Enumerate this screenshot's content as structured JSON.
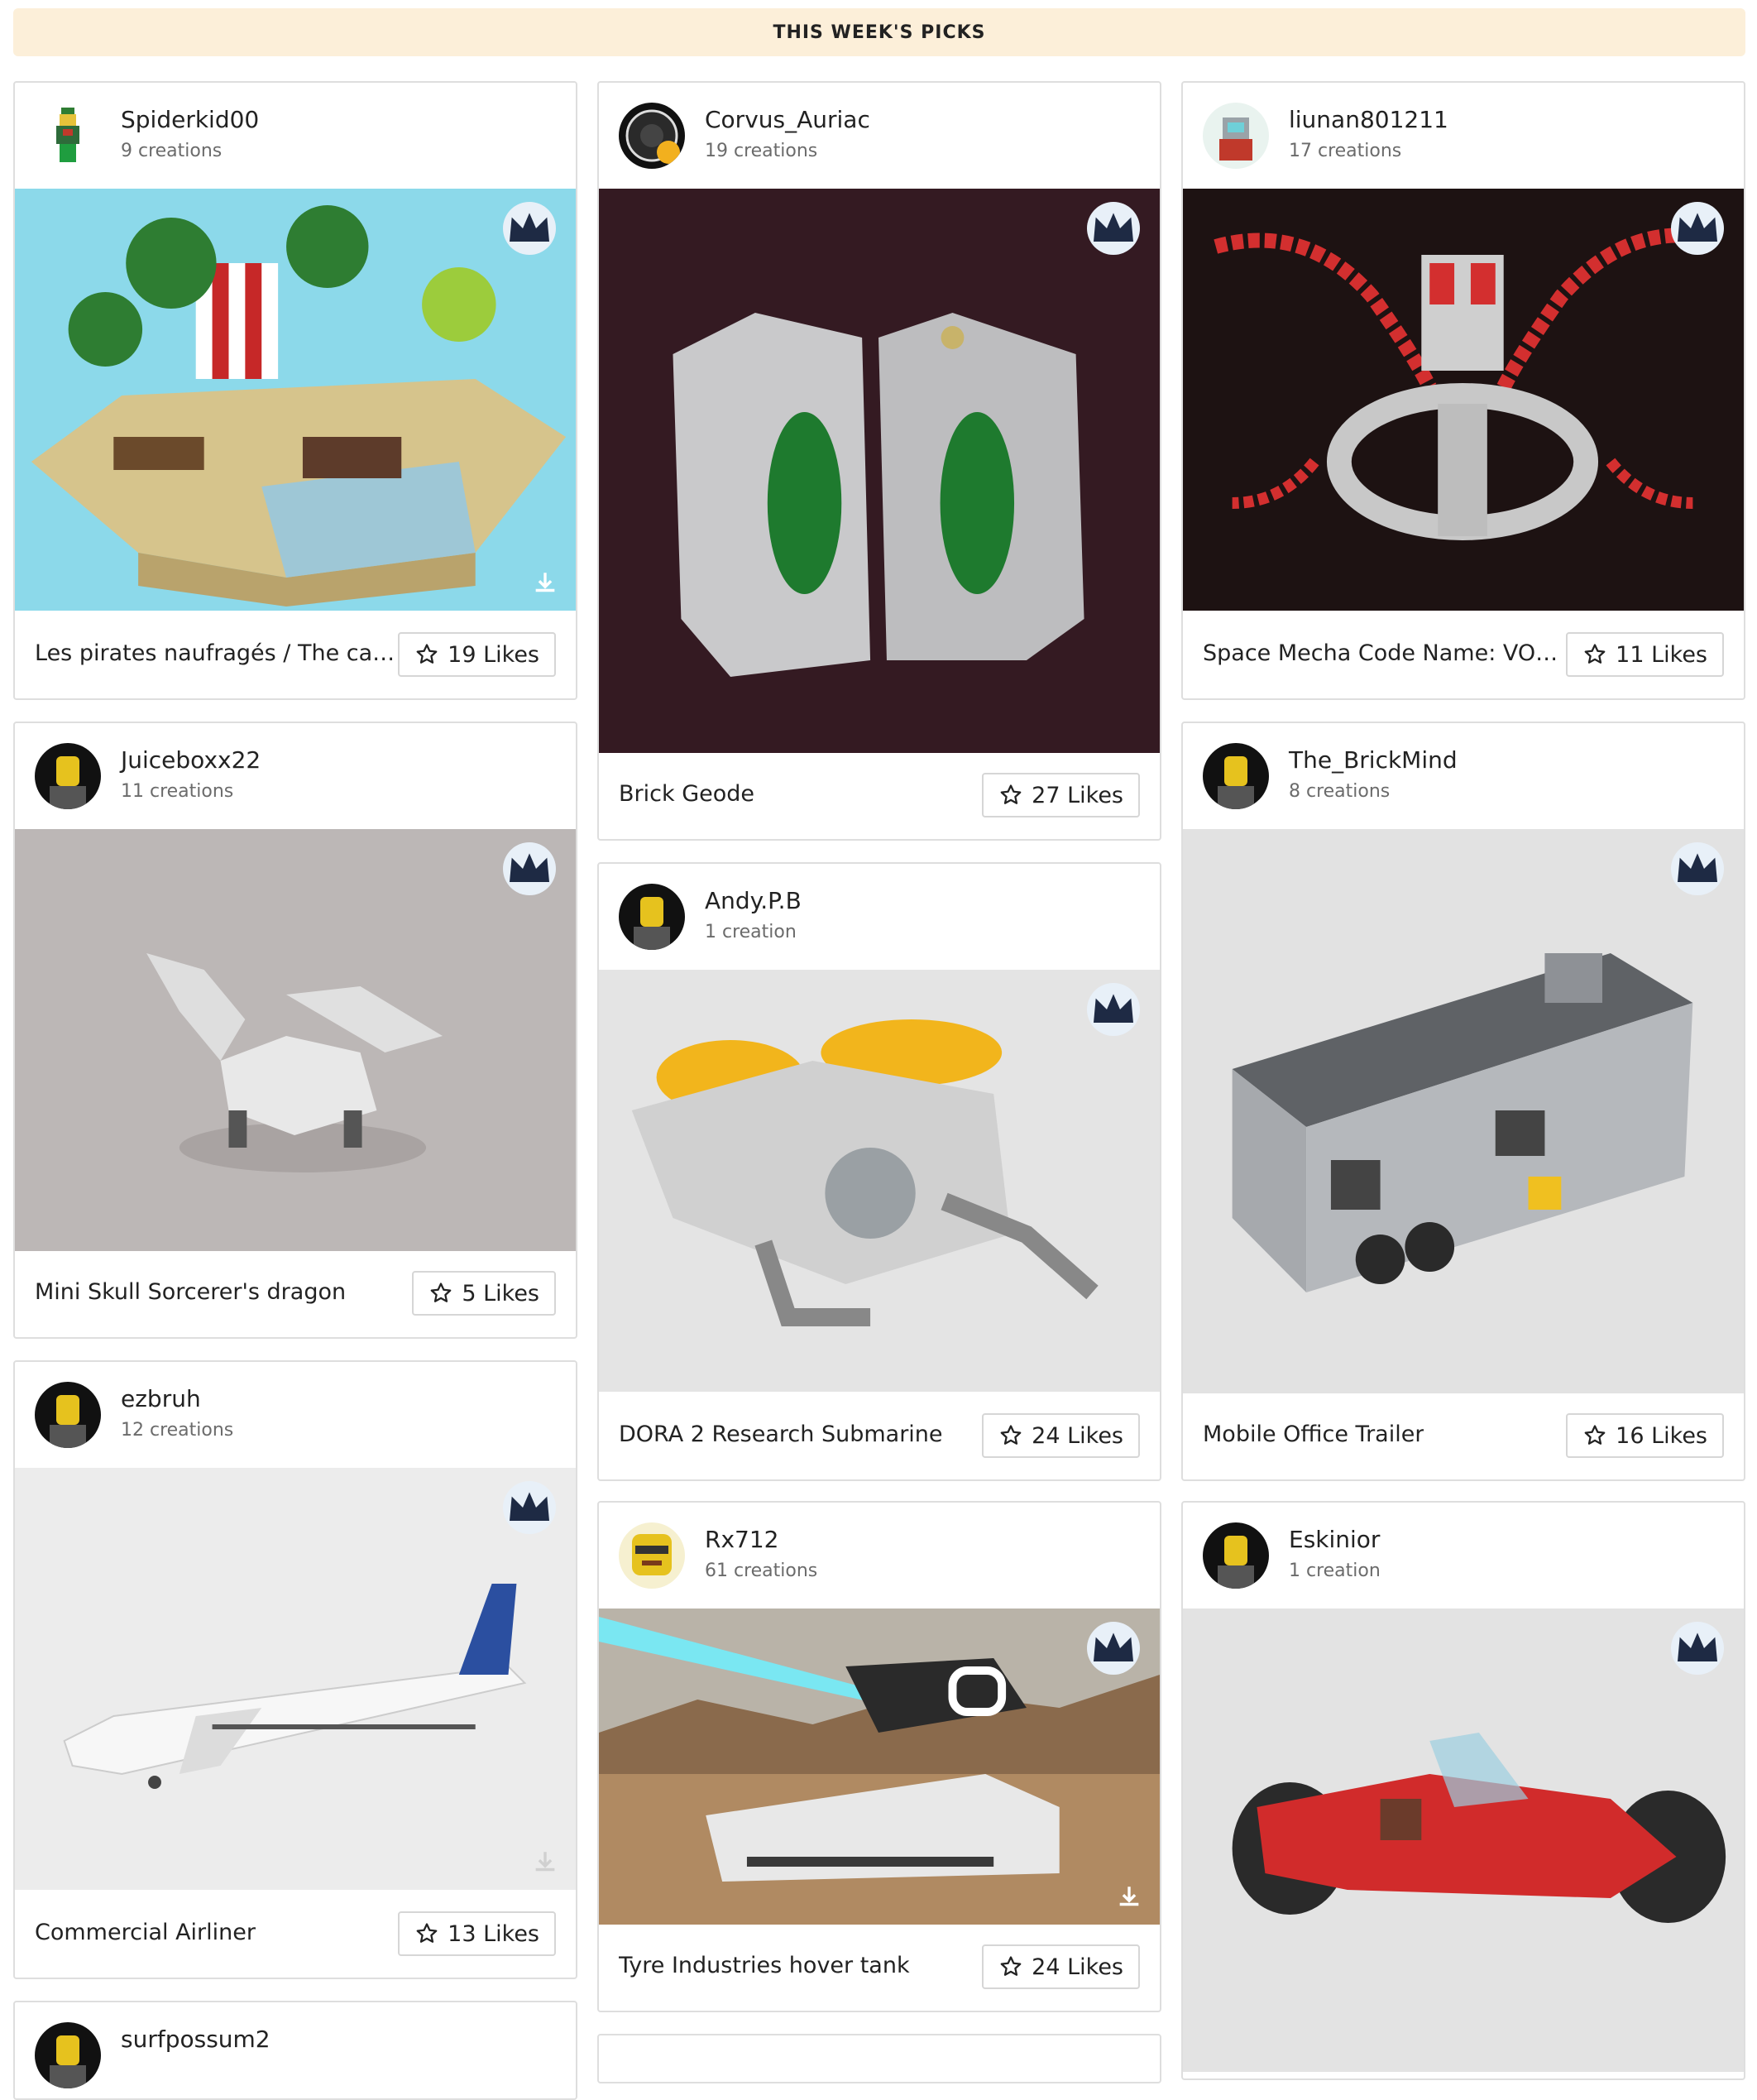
{
  "banner": {
    "text": "THIS WEEK'S PICKS"
  },
  "colors": {
    "banner_bg": "#fcefd9",
    "crown_bg": "#e8f0f8",
    "crown": "#1e2a44"
  },
  "cards": [
    {
      "user": "Spiderkid00",
      "creations": "9 creations",
      "title": "Les pirates naufragés / The cas...",
      "likes": "19 Likes",
      "image": "pirate-island-build"
    },
    {
      "user": "Corvus_Auriac",
      "creations": "19 creations",
      "title": "Brick Geode",
      "likes": "27 Likes",
      "image": "brick-geode-build"
    },
    {
      "user": "liunan801211",
      "creations": "17 creations",
      "title": "Space Mecha Code Name: VOO...",
      "likes": "11 Likes",
      "image": "space-mecha-build"
    },
    {
      "user": "Juiceboxx22",
      "creations": "11 creations",
      "title": "Mini Skull Sorcerer's dragon",
      "likes": "5 Likes",
      "image": "skull-dragon-build"
    },
    {
      "user": "The_BrickMind",
      "creations": "8 creations",
      "title": "Mobile Office Trailer",
      "likes": "16 Likes",
      "image": "office-trailer-build"
    },
    {
      "user": "Andy.P.B",
      "creations": "1 creation",
      "title": "DORA 2 Research Submarine",
      "likes": "24 Likes",
      "image": "research-submarine-build"
    },
    {
      "user": "ezbruh",
      "creations": "12 creations",
      "title": "Commercial Airliner",
      "likes": "13 Likes",
      "image": "airliner-build"
    },
    {
      "user": "Rx712",
      "creations": "61 creations",
      "title": "Tyre Industries hover tank",
      "likes": "24 Likes",
      "image": "hover-tank-build"
    },
    {
      "user": "Eskinior",
      "creations": "1 creation",
      "title": "",
      "likes": "",
      "image": "red-hoverbike-build"
    },
    {
      "user": "surfpossum2",
      "creations": "",
      "title": "",
      "likes": "",
      "image": ""
    }
  ]
}
